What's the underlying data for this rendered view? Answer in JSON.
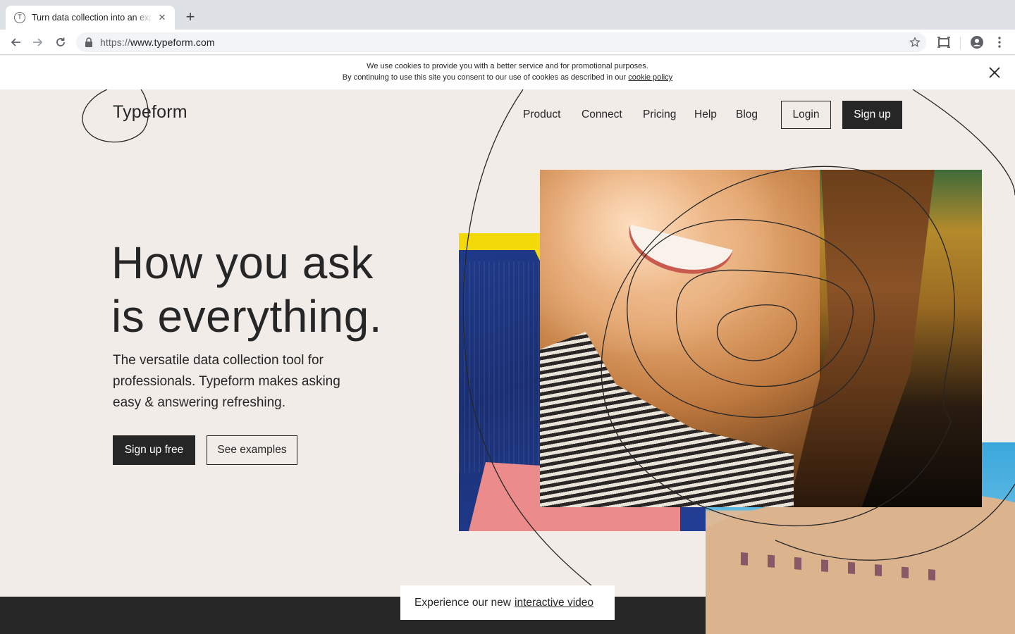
{
  "browser": {
    "tab_title": "Turn data collection into an experience",
    "favicon_letter": "T",
    "url_scheme": "https://",
    "url_host": "www.typeform.com"
  },
  "cookie_banner": {
    "line1": "We use cookies to provide you with a better service and for promotional purposes.",
    "line2": "By continuing to use this site you consent to our use of cookies as described in our",
    "link": "cookie policy"
  },
  "header": {
    "logo": "Typeform",
    "nav": [
      "Product",
      "Connect",
      "Pricing",
      "Help",
      "Blog"
    ],
    "login": "Login",
    "signup": "Sign up"
  },
  "hero": {
    "title_line1": "How you ask",
    "title_line2": "is everything.",
    "subtitle": "The versatile data collection tool for professionals. Typeform makes asking easy & answering refreshing.",
    "primary_cta": "Sign up free",
    "secondary_cta": "See examples"
  },
  "video_banner": {
    "text": "Experience our new",
    "link": "interactive video"
  },
  "colors": {
    "background": "#f1ece7",
    "ink": "#262627"
  }
}
